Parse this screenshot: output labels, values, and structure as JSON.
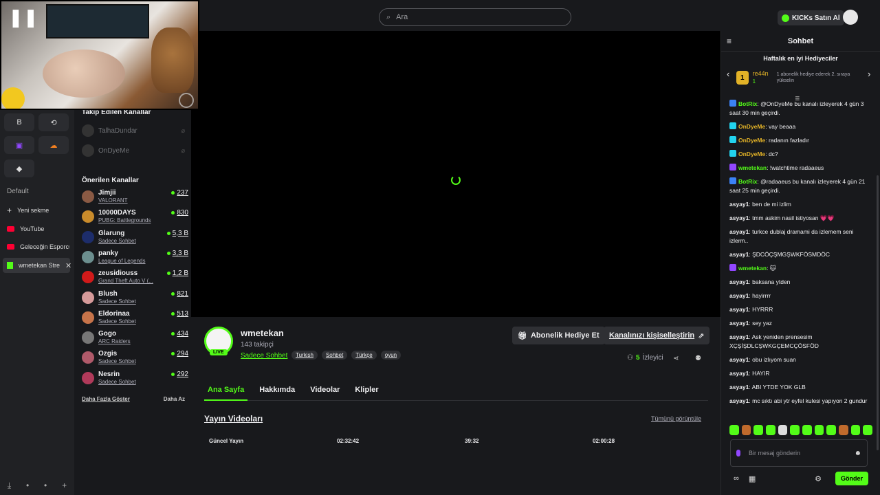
{
  "browser": {
    "pinned": [
      {
        "icon": "B",
        "name": "pinned-b"
      },
      {
        "icon": "⟲",
        "name": "pinned-loop"
      },
      {
        "icon": "▣",
        "name": "pinned-twitch"
      },
      {
        "icon": "☁",
        "name": "pinned-cloud"
      },
      {
        "icon": "◆",
        "name": "pinned-diamond"
      }
    ],
    "section_title": "Default",
    "tabs": [
      {
        "label": "Yeni sekme",
        "type": "new"
      },
      {
        "label": "YouTube",
        "type": "youtube"
      },
      {
        "label": "Geleceğin Esporcus",
        "type": "youtube"
      },
      {
        "label": "wmetekan Stre",
        "type": "kick",
        "active": true
      }
    ]
  },
  "sidebar": {
    "followed_title": "Takip Edilen Kanallar",
    "followed": [
      {
        "name": "TalhaDundar"
      },
      {
        "name": "OnDyeMe"
      }
    ],
    "recommended_title": "Önerilen Kanallar",
    "recommended": [
      {
        "name": "Jimjii",
        "category": "VALORANT",
        "viewers": "237",
        "color": "#8a5a44"
      },
      {
        "name": "10000DAYS",
        "category": "PUBG: Battlegrounds",
        "viewers": "830",
        "color": "#c98b2b"
      },
      {
        "name": "Glarung",
        "category": "Sadece Sohbet",
        "viewers": "5,3 B",
        "color": "#1d2d6b"
      },
      {
        "name": "panky",
        "category": "League of Legends",
        "viewers": "3,3 B",
        "color": "#6c8f8f"
      },
      {
        "name": "zeusidiouss",
        "category": "Grand Theft Auto V (...",
        "viewers": "1,2 B",
        "color": "#d11a1a"
      },
      {
        "name": "Blush",
        "category": "Sadece Sohbet",
        "viewers": "821",
        "color": "#d69a9a"
      },
      {
        "name": "Eldorinaa",
        "category": "Sadece Sohbet",
        "viewers": "513",
        "color": "#c7744a"
      },
      {
        "name": "Gogo",
        "category": "ARC Raiders",
        "viewers": "434",
        "color": "#777"
      },
      {
        "name": "Ozgis",
        "category": "Sadece Sohbet",
        "viewers": "294",
        "color": "#b05a6a"
      },
      {
        "name": "Nesrin",
        "category": "Sadece Sohbet",
        "viewers": "292",
        "color": "#b03a5a"
      }
    ],
    "show_more": "Daha Fazla Göster",
    "show_less": "Daha Az"
  },
  "topbar": {
    "search_placeholder": "Ara",
    "kicks_label": "KICKs Satın Al"
  },
  "channel": {
    "name": "wmetekan",
    "followers": "143 takipçi",
    "category": "Sadece Sohbet",
    "live_label": "LIVE",
    "tags": [
      "Turkish",
      "Sohbet",
      "Türkçe",
      "oyun"
    ],
    "gift_sub_label": "Abonelik Hediye Et",
    "customize_label": "Kanalınızı kişiselleştirin",
    "viewer_count": "5",
    "viewer_label": "İzleyici",
    "tabs": [
      "Ana Sayfa",
      "Hakkımda",
      "Videolar",
      "Klipler"
    ],
    "videos_title": "Yayın Videoları",
    "see_all": "Tümünü görüntüle",
    "videos": [
      {
        "label": "Güncel Yayın"
      },
      {
        "label": "02:32:42"
      },
      {
        "label": "39:32"
      },
      {
        "label": "02:00:28"
      }
    ]
  },
  "chat": {
    "title": "Sohbet",
    "gifters_title": "Haftalık en iyi Hediyeciler",
    "top_gifter": {
      "rank": "1",
      "name": "re44n",
      "count": "1"
    },
    "gifter_note": "1 abonelik hediye ederek 2. sıraya yükselin",
    "messages": [
      {
        "user": "BotRix",
        "color": "#53fc18",
        "badge": "#3b82f6",
        "text": "@OnDyeMe bu kanalı izleyerek 4 gün 3 saat 30 min geçirdi."
      },
      {
        "user": "OnDyeMe",
        "color": "#e2b227",
        "badge": "#22d3ee",
        "text": "vay beaaa"
      },
      {
        "user": "OnDyeMe",
        "color": "#e2b227",
        "badge": "#22d3ee",
        "text": "radanın fazladır"
      },
      {
        "user": "OnDyeMe",
        "color": "#e2b227",
        "badge": "#22d3ee",
        "text": "dc?"
      },
      {
        "user": "wmetekan",
        "color": "#53fc18",
        "badge": "#9147ff",
        "text": "!watchtime radaaeus"
      },
      {
        "user": "BotRix",
        "color": "#53fc18",
        "badge": "#3b82f6",
        "text": "@radaaeus bu kanalı izleyerek 4 gün 21 saat 25 min geçirdi."
      },
      {
        "user": "asyay1",
        "color": "#efeff1",
        "badge": "",
        "text": "ben de mi izlim"
      },
      {
        "user": "asyay1",
        "color": "#efeff1",
        "badge": "",
        "text": "tmm askim nasil istiyosan 💗💗"
      },
      {
        "user": "asyay1",
        "color": "#efeff1",
        "badge": "",
        "text": "turkce dublaj dramami da izlemem seni izlerm.."
      },
      {
        "user": "asyay1",
        "color": "#efeff1",
        "badge": "",
        "text": "ŞDCÖÇŞMGŞWKFÖSMDÖC"
      },
      {
        "user": "wmetekan",
        "color": "#53fc18",
        "badge": "#9147ff",
        "text": "🐱"
      },
      {
        "user": "asyay1",
        "color": "#efeff1",
        "badge": "",
        "text": "baksana ytden"
      },
      {
        "user": "asyay1",
        "color": "#efeff1",
        "badge": "",
        "text": "hayirrrr"
      },
      {
        "user": "asyay1",
        "color": "#efeff1",
        "badge": "",
        "text": "HYRRR"
      },
      {
        "user": "asyay1",
        "color": "#efeff1",
        "badge": "",
        "text": "sey yaz"
      },
      {
        "user": "asyay1",
        "color": "#efeff1",
        "badge": "",
        "text": "Ask yeniden prensesim XÇŞİŞDLCŞWKGÇEMCÇÖSFÖD"
      },
      {
        "user": "asyay1",
        "color": "#efeff1",
        "badge": "",
        "text": "obu izlıyom suan"
      },
      {
        "user": "asyay1",
        "color": "#efeff1",
        "badge": "",
        "text": "HAYIR"
      },
      {
        "user": "asyay1",
        "color": "#efeff1",
        "badge": "",
        "text": "ABI YTDE YOK GLB"
      },
      {
        "user": "asyay1",
        "color": "#efeff1",
        "badge": "",
        "text": "mc sıktı abi ytr eyfel kulesi yapıyon 2 gundur"
      }
    ],
    "input_placeholder": "Bir mesaj gönderin",
    "send_label": "Gönder"
  }
}
